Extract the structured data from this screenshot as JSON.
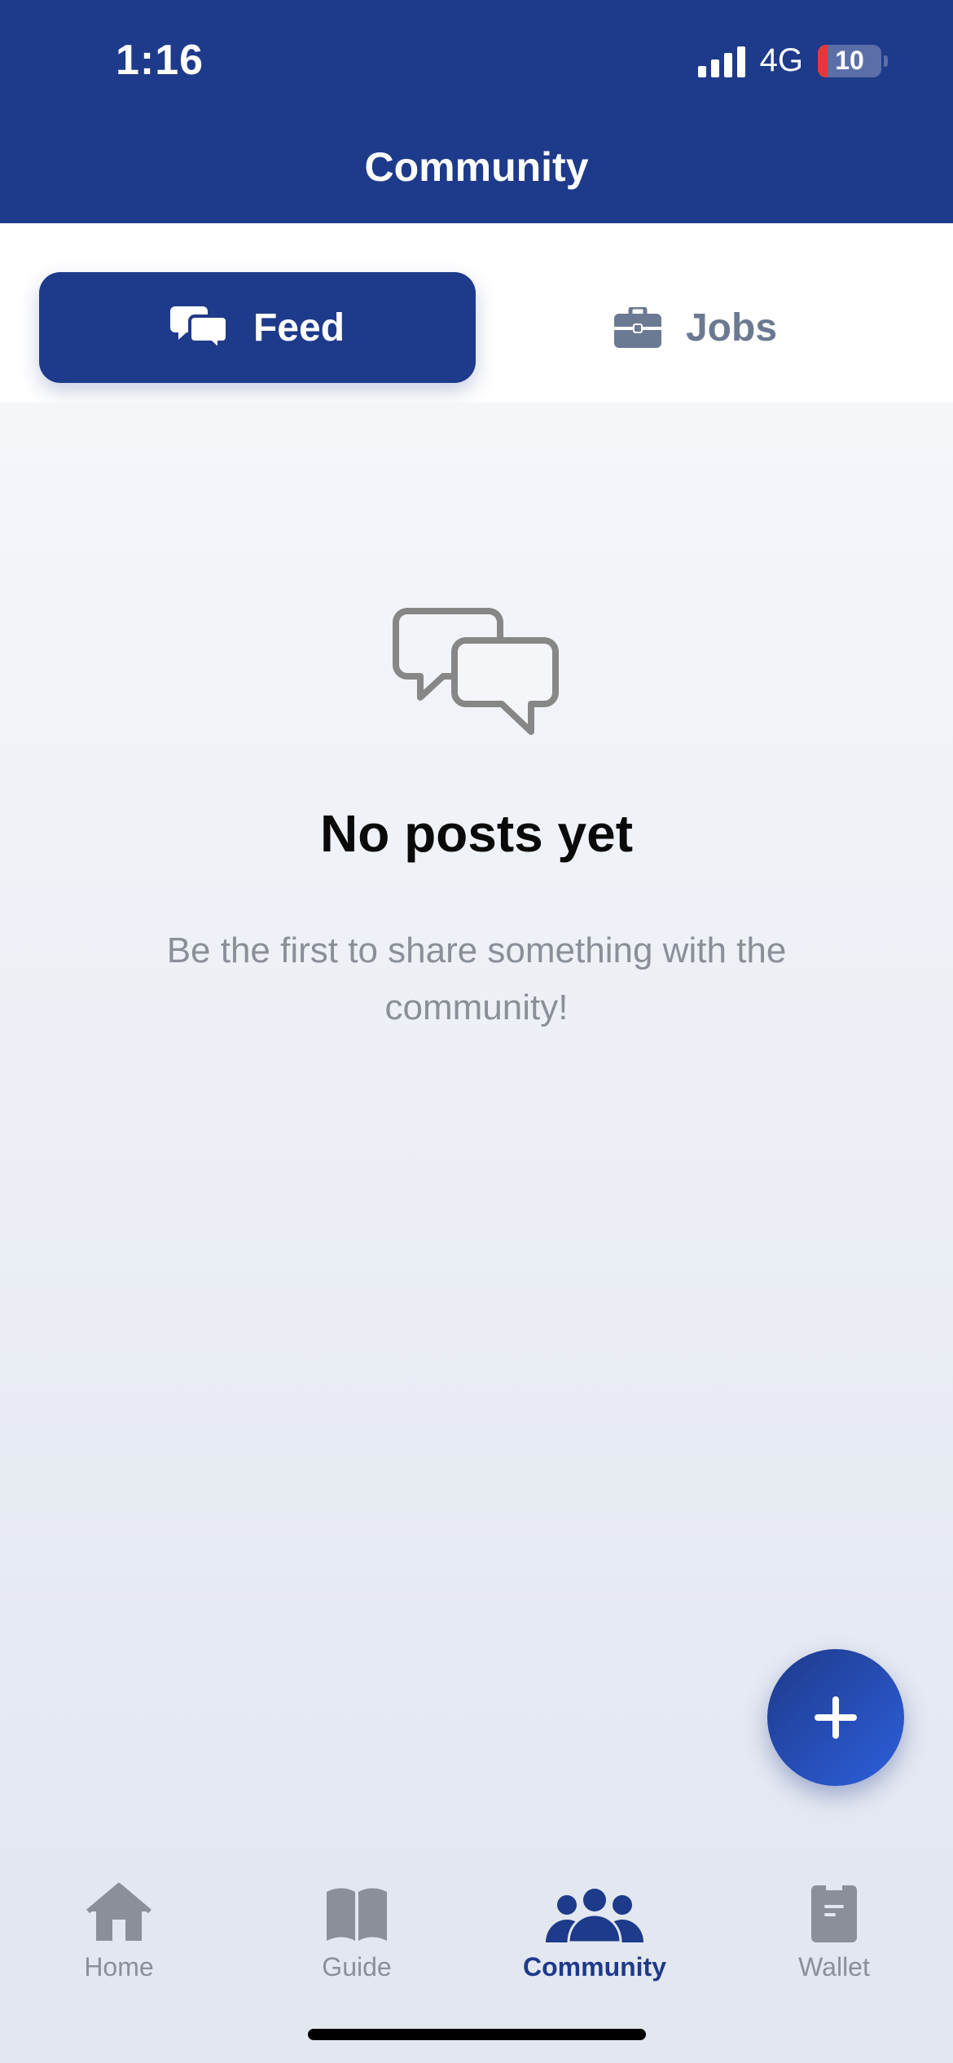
{
  "status_bar": {
    "time": "1:16",
    "network": "4G",
    "battery": "10"
  },
  "header": {
    "title": "Community"
  },
  "tabs": [
    {
      "label": "Feed",
      "icon": "chat-bubbles-icon",
      "active": true
    },
    {
      "label": "Jobs",
      "icon": "briefcase-icon",
      "active": false
    }
  ],
  "empty_state": {
    "icon": "chat-bubbles-outline-icon",
    "title": "No posts yet",
    "subtitle": "Be the first to share something with the community!"
  },
  "fab": {
    "icon": "plus-icon"
  },
  "bottom_nav": [
    {
      "label": "Home",
      "icon": "house-icon",
      "active": false
    },
    {
      "label": "Guide",
      "icon": "book-icon",
      "active": false
    },
    {
      "label": "Community",
      "icon": "people-icon",
      "active": true
    },
    {
      "label": "Wallet",
      "icon": "wallet-icon",
      "active": false
    }
  ],
  "colors": {
    "primary": "#1e3a8a",
    "inactive": "#8a8f99",
    "background": "#f3f5f9"
  }
}
